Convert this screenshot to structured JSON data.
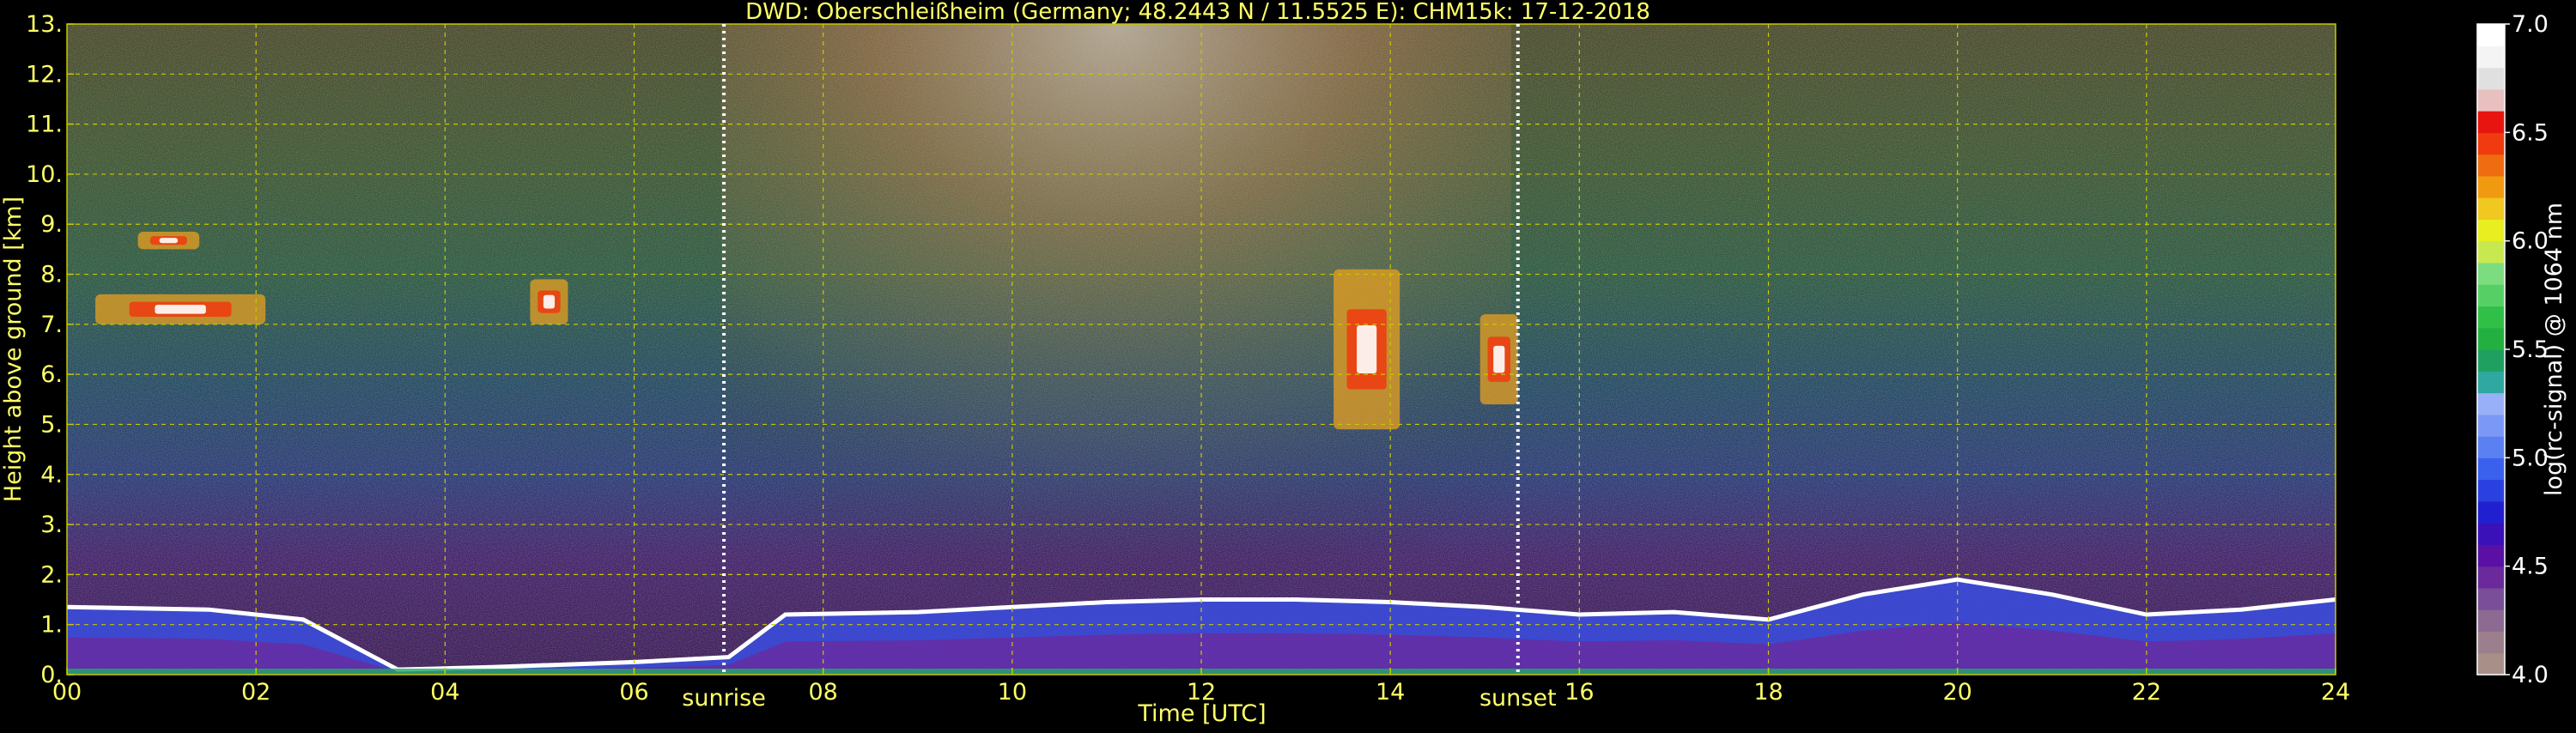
{
  "colors": {
    "background": "#000000",
    "annotation_text": "#ffff66",
    "grid": "#c8c800",
    "cbar_text": "#ffffff"
  },
  "chart_data": {
    "type": "heatmap",
    "title": "DWD: Oberschleißheim (Germany; 48.2443 N / 11.5525 E):    CHM15k: 17-12-2018",
    "xlabel": "Time [UTC]",
    "ylabel": "Height above ground [km]",
    "xlim": [
      0,
      24
    ],
    "ylim": [
      0,
      13
    ],
    "x_ticks": [
      0,
      2,
      4,
      6,
      8,
      10,
      12,
      14,
      16,
      18,
      20,
      22,
      24
    ],
    "x_tick_labels": [
      "00",
      "02",
      "04",
      "06",
      "08",
      "10",
      "12",
      "14",
      "16",
      "18",
      "20",
      "22",
      "24"
    ],
    "y_ticks": [
      0,
      1,
      2,
      3,
      4,
      5,
      6,
      7,
      8,
      9,
      10,
      11,
      12,
      13
    ],
    "y_tick_labels": [
      "0.",
      "1.",
      "2.",
      "3.",
      "4.",
      "5.",
      "6.",
      "7.",
      "8.",
      "9.",
      "10.",
      "11.",
      "12.",
      "13."
    ],
    "grid": true,
    "markers": [
      {
        "name": "sunrise",
        "time": 6.95
      },
      {
        "name": "sunset",
        "time": 15.35
      }
    ],
    "colorbar": {
      "label": "log(rc-signal) @ 1064 nm",
      "range": [
        4.0,
        7.0
      ],
      "ticks": [
        4.0,
        4.5,
        5.0,
        5.5,
        6.0,
        6.5,
        7.0
      ],
      "tick_labels": [
        "4.0",
        "4.5",
        "5.0",
        "5.5",
        "6.0",
        "6.5",
        "7.0"
      ],
      "colors": [
        "#a89088",
        "#9c7f8c",
        "#8c6a92",
        "#7a4e98",
        "#6a2a9c",
        "#5a10a4",
        "#3a10b8",
        "#2020d0",
        "#2a40e0",
        "#3a60ee",
        "#5a80f2",
        "#7c98f6",
        "#98b0f8",
        "#2ea8a0",
        "#20a060",
        "#24b040",
        "#30c048",
        "#56d064",
        "#7cdc80",
        "#c8e850",
        "#e8ee20",
        "#f0c820",
        "#f09a10",
        "#f06c10",
        "#f03a10",
        "#e81410",
        "#e8c0c0",
        "#e0e0e0",
        "#f4f4f4",
        "#ffffff"
      ]
    },
    "features": [
      {
        "kind": "boundary_layer",
        "points": [
          [
            0,
            1.35
          ],
          [
            1.5,
            1.3
          ],
          [
            2.5,
            1.1
          ],
          [
            3.5,
            0.1
          ],
          [
            4.5,
            0.15
          ],
          [
            6,
            0.25
          ],
          [
            7,
            0.35
          ],
          [
            7.6,
            1.2
          ],
          [
            9,
            1.25
          ],
          [
            10,
            1.35
          ],
          [
            11,
            1.45
          ],
          [
            12,
            1.5
          ],
          [
            13,
            1.5
          ],
          [
            14,
            1.45
          ],
          [
            15,
            1.35
          ],
          [
            16,
            1.2
          ],
          [
            17,
            1.25
          ],
          [
            18,
            1.1
          ],
          [
            19,
            1.6
          ],
          [
            20,
            1.9
          ],
          [
            21,
            1.6
          ],
          [
            22,
            1.2
          ],
          [
            23,
            1.3
          ],
          [
            24,
            1.5
          ]
        ]
      },
      {
        "kind": "cloud",
        "t0": 0.75,
        "t1": 1.4,
        "h0": 8.5,
        "h1": 8.85
      },
      {
        "kind": "cloud",
        "t0": 0.3,
        "t1": 2.1,
        "h0": 7.0,
        "h1": 7.6
      },
      {
        "kind": "cloud",
        "t0": 4.9,
        "t1": 5.3,
        "h0": 7.0,
        "h1": 7.9
      },
      {
        "kind": "cloud",
        "t0": 13.4,
        "t1": 14.1,
        "h0": 4.9,
        "h1": 8.1
      },
      {
        "kind": "cloud",
        "t0": 14.95,
        "t1": 15.35,
        "h0": 5.4,
        "h1": 7.2
      }
    ]
  }
}
